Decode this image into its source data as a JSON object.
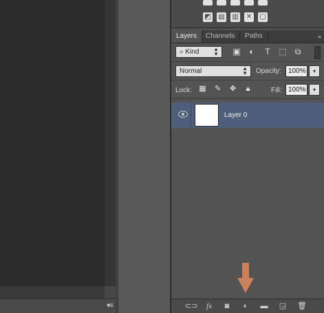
{
  "layers_panel": {
    "tabs": [
      "Layers",
      "Channels",
      "Paths"
    ],
    "active_tab": "Layers",
    "filter": {
      "kind_label": "Kind"
    },
    "blend_mode": "Normal",
    "opacity": {
      "label": "Opacity:",
      "value": "100%"
    },
    "lock": {
      "label": "Lock:"
    },
    "fill": {
      "label": "Fill:",
      "value": "100%"
    },
    "layers": [
      {
        "name": "Layer 0",
        "visible": true,
        "selected": true
      }
    ],
    "footer_icons": [
      "link-icon",
      "fx-icon",
      "mask-icon",
      "adjustment-icon",
      "folder-icon",
      "new-layer-icon",
      "trash-icon"
    ]
  },
  "annotation": {
    "arrow_color": "#c8825a",
    "points_to": "adjustment-icon"
  },
  "colors": {
    "selected_layer": "#4d5f7a",
    "panel_bg": "#535353",
    "canvas_bg": "#2a2a2a"
  }
}
